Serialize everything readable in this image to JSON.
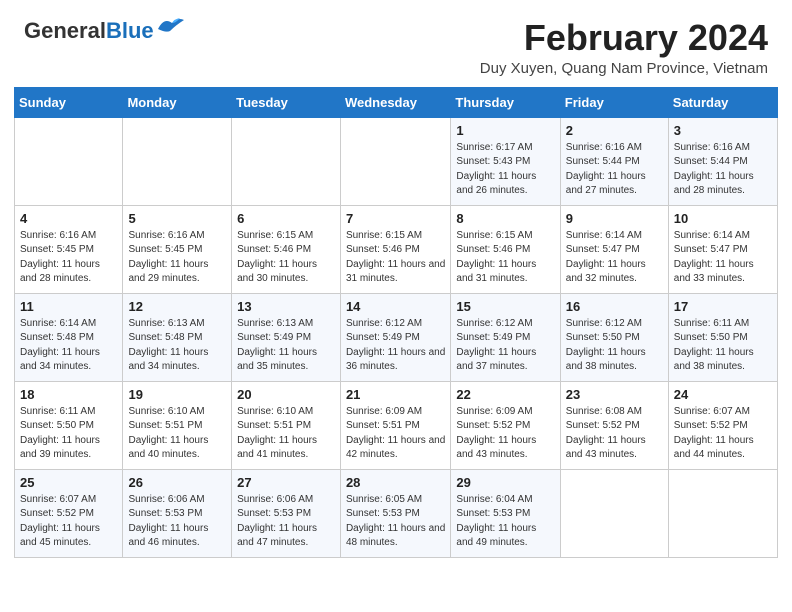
{
  "header": {
    "logo_general": "General",
    "logo_blue": "Blue",
    "title": "February 2024",
    "subtitle": "Duy Xuyen, Quang Nam Province, Vietnam"
  },
  "days_of_week": [
    "Sunday",
    "Monday",
    "Tuesday",
    "Wednesday",
    "Thursday",
    "Friday",
    "Saturday"
  ],
  "weeks": [
    [
      {
        "num": "",
        "info": ""
      },
      {
        "num": "",
        "info": ""
      },
      {
        "num": "",
        "info": ""
      },
      {
        "num": "",
        "info": ""
      },
      {
        "num": "1",
        "info": "Sunrise: 6:17 AM\nSunset: 5:43 PM\nDaylight: 11 hours and 26 minutes."
      },
      {
        "num": "2",
        "info": "Sunrise: 6:16 AM\nSunset: 5:44 PM\nDaylight: 11 hours and 27 minutes."
      },
      {
        "num": "3",
        "info": "Sunrise: 6:16 AM\nSunset: 5:44 PM\nDaylight: 11 hours and 28 minutes."
      }
    ],
    [
      {
        "num": "4",
        "info": "Sunrise: 6:16 AM\nSunset: 5:45 PM\nDaylight: 11 hours and 28 minutes."
      },
      {
        "num": "5",
        "info": "Sunrise: 6:16 AM\nSunset: 5:45 PM\nDaylight: 11 hours and 29 minutes."
      },
      {
        "num": "6",
        "info": "Sunrise: 6:15 AM\nSunset: 5:46 PM\nDaylight: 11 hours and 30 minutes."
      },
      {
        "num": "7",
        "info": "Sunrise: 6:15 AM\nSunset: 5:46 PM\nDaylight: 11 hours and 31 minutes."
      },
      {
        "num": "8",
        "info": "Sunrise: 6:15 AM\nSunset: 5:46 PM\nDaylight: 11 hours and 31 minutes."
      },
      {
        "num": "9",
        "info": "Sunrise: 6:14 AM\nSunset: 5:47 PM\nDaylight: 11 hours and 32 minutes."
      },
      {
        "num": "10",
        "info": "Sunrise: 6:14 AM\nSunset: 5:47 PM\nDaylight: 11 hours and 33 minutes."
      }
    ],
    [
      {
        "num": "11",
        "info": "Sunrise: 6:14 AM\nSunset: 5:48 PM\nDaylight: 11 hours and 34 minutes."
      },
      {
        "num": "12",
        "info": "Sunrise: 6:13 AM\nSunset: 5:48 PM\nDaylight: 11 hours and 34 minutes."
      },
      {
        "num": "13",
        "info": "Sunrise: 6:13 AM\nSunset: 5:49 PM\nDaylight: 11 hours and 35 minutes."
      },
      {
        "num": "14",
        "info": "Sunrise: 6:12 AM\nSunset: 5:49 PM\nDaylight: 11 hours and 36 minutes."
      },
      {
        "num": "15",
        "info": "Sunrise: 6:12 AM\nSunset: 5:49 PM\nDaylight: 11 hours and 37 minutes."
      },
      {
        "num": "16",
        "info": "Sunrise: 6:12 AM\nSunset: 5:50 PM\nDaylight: 11 hours and 38 minutes."
      },
      {
        "num": "17",
        "info": "Sunrise: 6:11 AM\nSunset: 5:50 PM\nDaylight: 11 hours and 38 minutes."
      }
    ],
    [
      {
        "num": "18",
        "info": "Sunrise: 6:11 AM\nSunset: 5:50 PM\nDaylight: 11 hours and 39 minutes."
      },
      {
        "num": "19",
        "info": "Sunrise: 6:10 AM\nSunset: 5:51 PM\nDaylight: 11 hours and 40 minutes."
      },
      {
        "num": "20",
        "info": "Sunrise: 6:10 AM\nSunset: 5:51 PM\nDaylight: 11 hours and 41 minutes."
      },
      {
        "num": "21",
        "info": "Sunrise: 6:09 AM\nSunset: 5:51 PM\nDaylight: 11 hours and 42 minutes."
      },
      {
        "num": "22",
        "info": "Sunrise: 6:09 AM\nSunset: 5:52 PM\nDaylight: 11 hours and 43 minutes."
      },
      {
        "num": "23",
        "info": "Sunrise: 6:08 AM\nSunset: 5:52 PM\nDaylight: 11 hours and 43 minutes."
      },
      {
        "num": "24",
        "info": "Sunrise: 6:07 AM\nSunset: 5:52 PM\nDaylight: 11 hours and 44 minutes."
      }
    ],
    [
      {
        "num": "25",
        "info": "Sunrise: 6:07 AM\nSunset: 5:52 PM\nDaylight: 11 hours and 45 minutes."
      },
      {
        "num": "26",
        "info": "Sunrise: 6:06 AM\nSunset: 5:53 PM\nDaylight: 11 hours and 46 minutes."
      },
      {
        "num": "27",
        "info": "Sunrise: 6:06 AM\nSunset: 5:53 PM\nDaylight: 11 hours and 47 minutes."
      },
      {
        "num": "28",
        "info": "Sunrise: 6:05 AM\nSunset: 5:53 PM\nDaylight: 11 hours and 48 minutes."
      },
      {
        "num": "29",
        "info": "Sunrise: 6:04 AM\nSunset: 5:53 PM\nDaylight: 11 hours and 49 minutes."
      },
      {
        "num": "",
        "info": ""
      },
      {
        "num": "",
        "info": ""
      }
    ]
  ]
}
